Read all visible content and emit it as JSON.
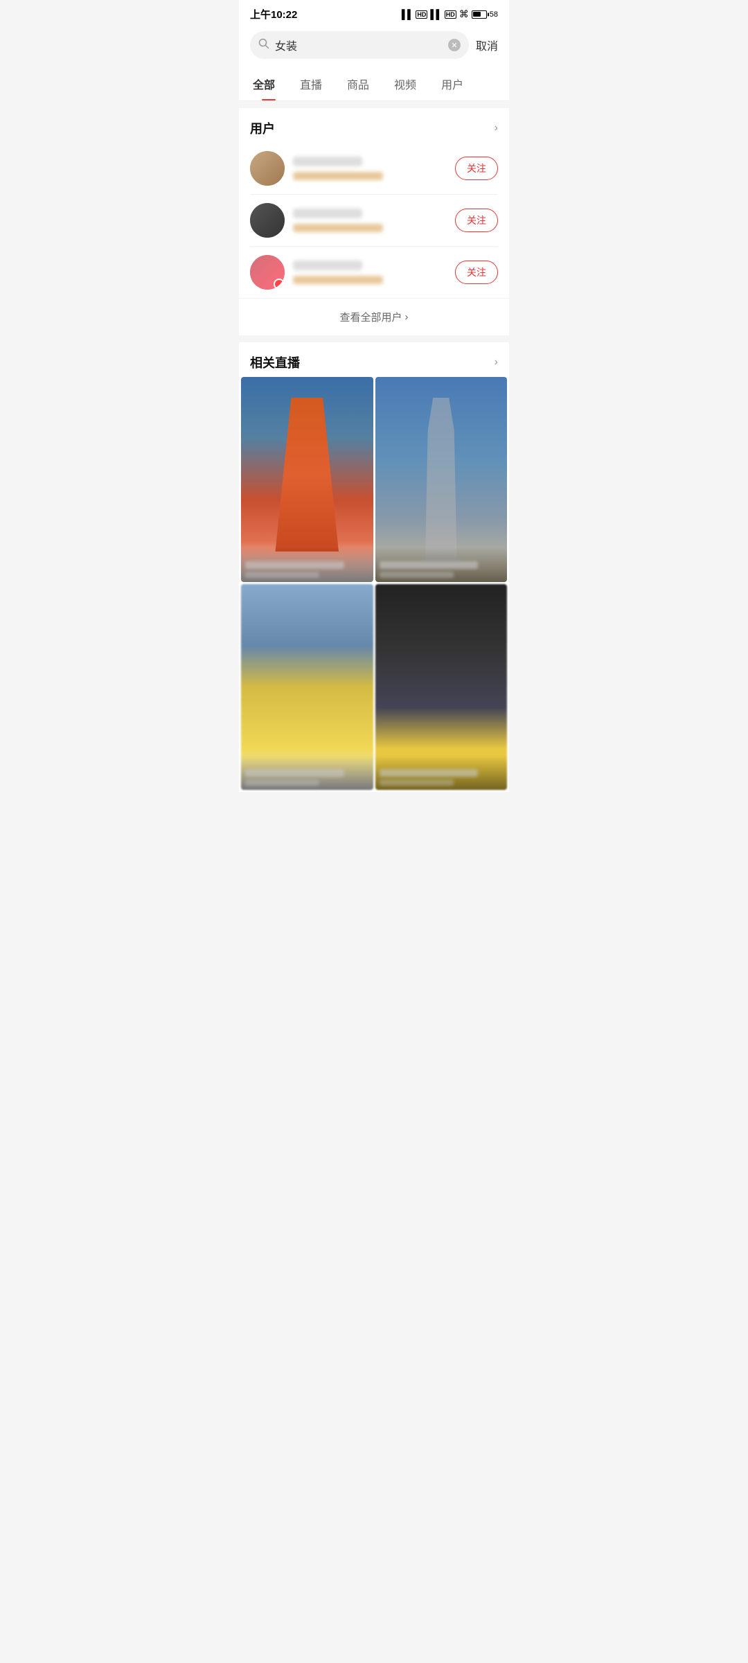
{
  "statusBar": {
    "time": "上午10:22",
    "battery": "58"
  },
  "searchBar": {
    "query": "女装",
    "cancel_label": "取消"
  },
  "tabs": [
    {
      "label": "全部",
      "active": true
    },
    {
      "label": "直播",
      "active": false
    },
    {
      "label": "商品",
      "active": false
    },
    {
      "label": "视频",
      "active": false
    },
    {
      "label": "用户",
      "active": false
    }
  ],
  "usersSection": {
    "title": "用户",
    "viewAll": "查看全部用户",
    "followLabel": "关注",
    "users": [
      {
        "id": 1
      },
      {
        "id": 2
      },
      {
        "id": 3
      }
    ]
  },
  "liveSection": {
    "title": "相关直播",
    "cards": [
      {
        "id": 1
      },
      {
        "id": 2
      },
      {
        "id": 3
      },
      {
        "id": 4
      }
    ]
  }
}
